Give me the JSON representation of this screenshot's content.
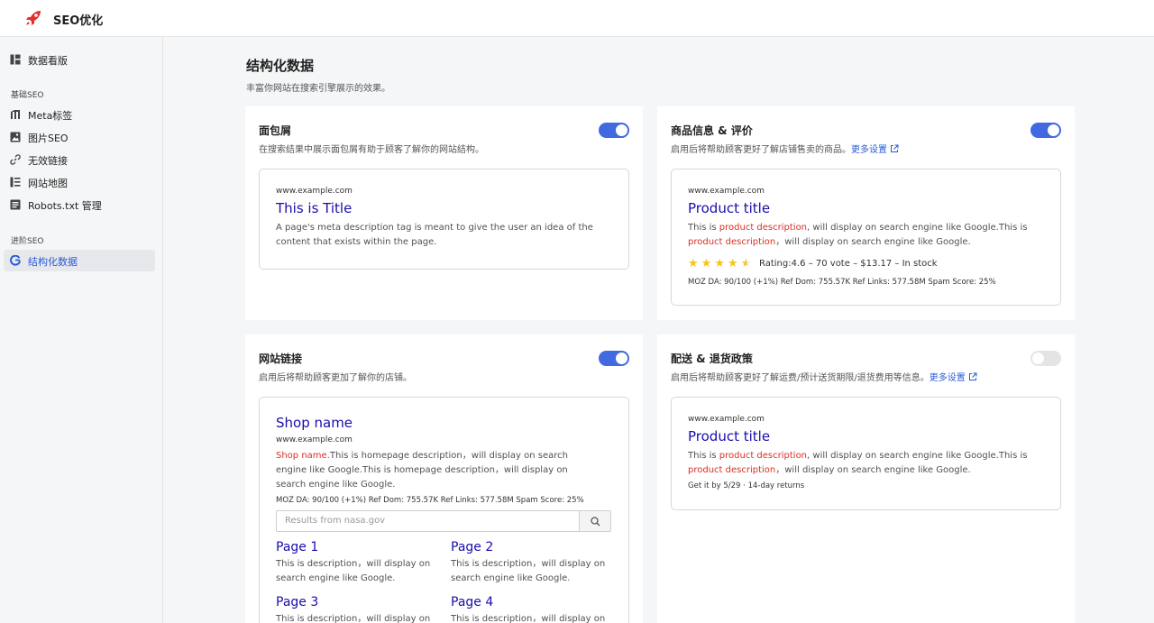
{
  "app": {
    "title": "SEO优化"
  },
  "sidebar": {
    "dashboard": "数据看版",
    "group_basic": "基础SEO",
    "meta": "Meta标签",
    "image_seo": "图片SEO",
    "broken_links": "无效链接",
    "sitemap": "网站地图",
    "robots": "Robots.txt 管理",
    "group_advanced": "进阶SEO",
    "structured": "结构化数据"
  },
  "page": {
    "title": "结构化数据",
    "subtitle": "丰富你网站在搜索引擎展示的效果。"
  },
  "cards": {
    "breadcrumb": {
      "title": "面包屑",
      "desc": "在搜索结果中展示面包屑有助于顾客了解你的网站结构。",
      "enabled": true,
      "url": "www.example.com",
      "p_title": "This is Title",
      "p_text": "A page's meta description tag is meant to give the user an idea of the content that exists within the page."
    },
    "product": {
      "title": "商品信息 & 评价",
      "desc": "启用后将帮助顾客更好了解店铺售卖的商品。",
      "more": "更多设置",
      "enabled": true,
      "url": "www.example.com",
      "p_title": "Product title",
      "t1": "This is ",
      "t2": "product description",
      "t3": ", will display on search engine like Google.This is ",
      "t4": "product description",
      "t5": "，will display on search engine like Google.",
      "rating": 4.6,
      "rating_text": "Rating:4.6 – 70 vote – $13.17 – In stock",
      "moz": "MOZ DA: 90/100 (+1%) Ref Dom: 755.57K Ref Links: 577.58M Spam Score: 25%"
    },
    "sitelinks": {
      "title": "网站链接",
      "desc": "启用后将帮助顾客更加了解你的店铺。",
      "enabled": true,
      "shop_name": "Shop name",
      "url": "www.example.com",
      "t1": "Shop name.",
      "t2": "This is homepage description，will display on search engine like Google.This is homepage description，will display on search engine like Google.",
      "moz": "MOZ DA: 90/100 (+1%) Ref Dom: 755.57K Ref Links: 577.58M Spam Score: 25%",
      "search_placeholder": "Results from nasa.gov",
      "pages": [
        {
          "title": "Page 1",
          "desc": "This is description，will display on search engine like Google."
        },
        {
          "title": "Page 2",
          "desc": "This is description，will display on search engine like Google."
        },
        {
          "title": "Page 3",
          "desc": "This is description，will display on search engine like Google."
        },
        {
          "title": "Page 4",
          "desc": "This is description，will display on search engine like Google."
        }
      ]
    },
    "shipping": {
      "title": "配送 & 退货政策",
      "desc": "启用后将帮助顾客更好了解运费/预计送货期限/退货费用等信息。",
      "more": "更多设置",
      "enabled": false,
      "url": "www.example.com",
      "p_title": "Product title",
      "t1": "This is ",
      "t2": "product description",
      "t3": ", will display on search engine like Google.This is ",
      "t4": "product description",
      "t5": "，will display on search engine like Google.",
      "delivery": "Get it by 5/29 · 14-day returns"
    }
  },
  "colors": {
    "accent": "#4169e1",
    "link": "#1a0dab",
    "red": "#d93025",
    "star": "#f5c518"
  },
  "icons": [
    "rocket-logo-icon",
    "dashboard-icon",
    "tag-icon",
    "image-icon",
    "link-icon",
    "list-icon",
    "file-icon",
    "google-icon",
    "external-link-icon",
    "search-icon",
    "star-icon"
  ]
}
